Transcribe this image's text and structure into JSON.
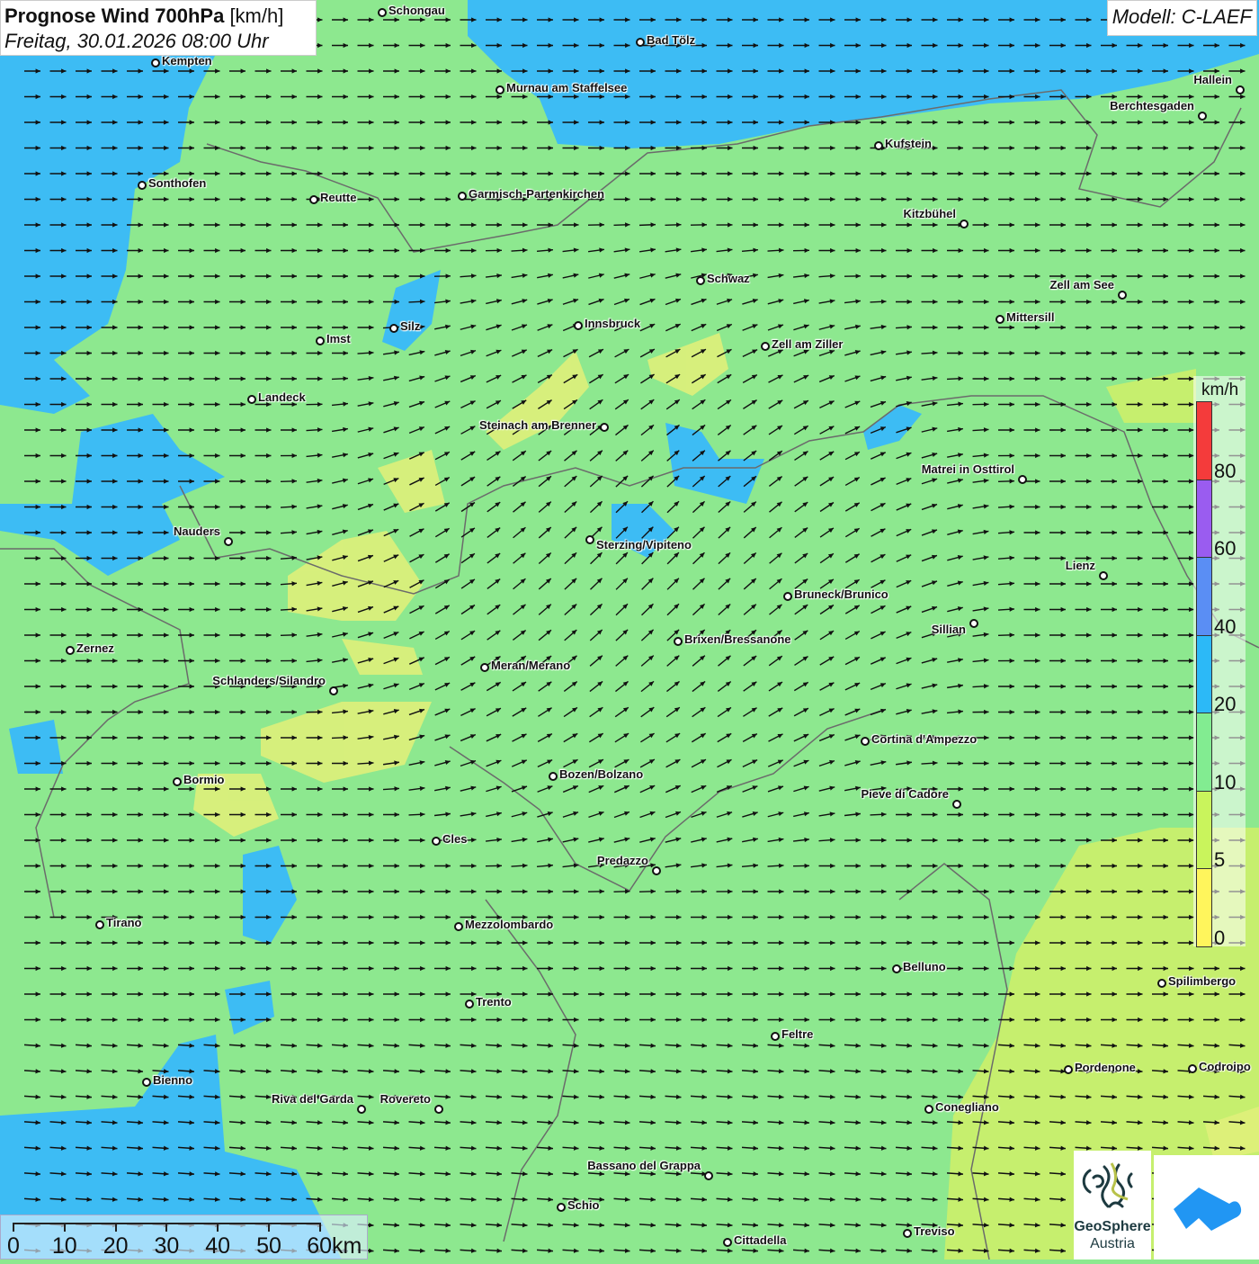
{
  "header": {
    "title_bold": "Prognose Wind 700hPa",
    "title_unit": "[km/h]",
    "subtitle": "Freitag, 30.01.2026 08:00 Uhr"
  },
  "model": "Modell: C-LAEF",
  "legend": {
    "unit": "km/h",
    "ticks": [
      "80",
      "60",
      "40",
      "20",
      "10",
      "5",
      "0"
    ],
    "colors": [
      "#f43b3b",
      "#9a5cf0",
      "#5a8ef4",
      "#2cb9f7",
      "#82ec91",
      "#c9f45c",
      "#fff55c"
    ]
  },
  "scale": {
    "labels": [
      "0",
      "10",
      "20",
      "30",
      "40",
      "50",
      "60km"
    ]
  },
  "logo": {
    "name1": "GeoSphere",
    "name2": "Austria"
  },
  "colors": {
    "base": "#8de88f",
    "blue": "#3dbcf4",
    "lime": "#c6ef6e",
    "yellow": "#e6f27a",
    "border": "#6b6b6b",
    "arrow": "#111111"
  },
  "cities": [
    "Schongau",
    "Bad Tölz",
    "Kempten",
    "Murnau am Staffelsee",
    "Hallein",
    "Berchtesgaden",
    "Kufstein",
    "Sonthofen",
    "Reutte",
    "Garmisch-Partenkirchen",
    "Kitzbühel",
    "Schwaz",
    "Zell am See",
    "Innsbruck",
    "Silz",
    "Mittersill",
    "Imst",
    "Zell am Ziller",
    "Landeck",
    "Steinach am Brenner",
    "Matrei in Osttirol",
    "Nauders",
    "Sterzing/Vipiteno",
    "Lienz",
    "Bruneck/Brunico",
    "Sillian",
    "Brixen/Bressanone",
    "Zernez",
    "Meran/Merano",
    "Schlanders/Silandro",
    "Cortina d'Ampezzo",
    "Bozen/Bolzano",
    "Bormio",
    "Pieve di Cadore",
    "Cles",
    "Predazzo",
    "Tirano",
    "Mezzolombardo",
    "Belluno",
    "Spilimbergo",
    "Trento",
    "Feltre",
    "Pordenone",
    "Codroipo",
    "Bienno",
    "Riva del Garda",
    "Rovereto",
    "Conegliano",
    "Bassano del Grappa",
    "Schio",
    "Treviso",
    "Cittadella"
  ]
}
